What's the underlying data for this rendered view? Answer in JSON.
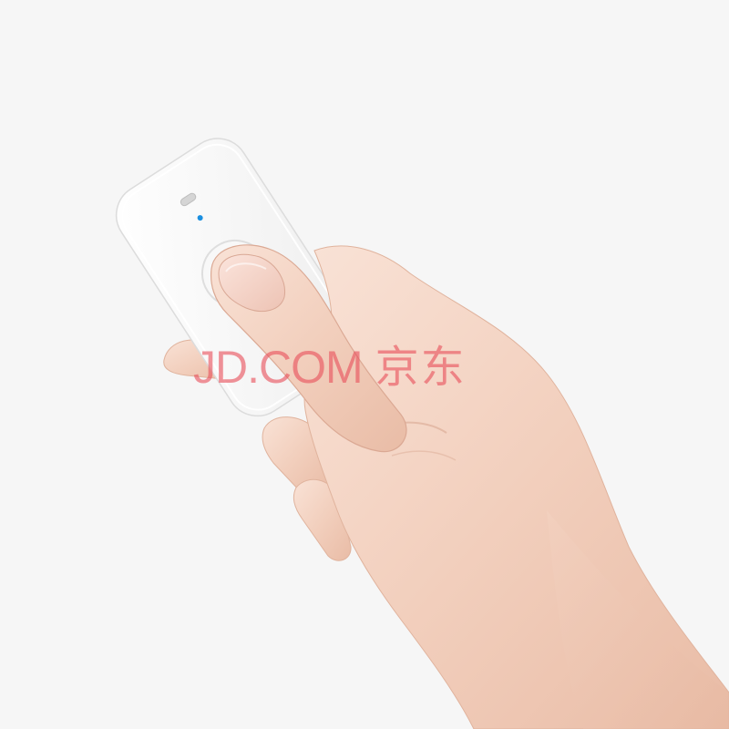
{
  "watermark": {
    "latin": "JD.COM",
    "cjk": "京东"
  },
  "colors": {
    "background": "#f6f6f6",
    "device": "#fdfdfd",
    "led": "#1a8fe0",
    "skin": "#f4d6c6",
    "watermark": "#e8505c"
  },
  "icons": {
    "status_led": "led-indicator",
    "button": "round-press-button"
  }
}
